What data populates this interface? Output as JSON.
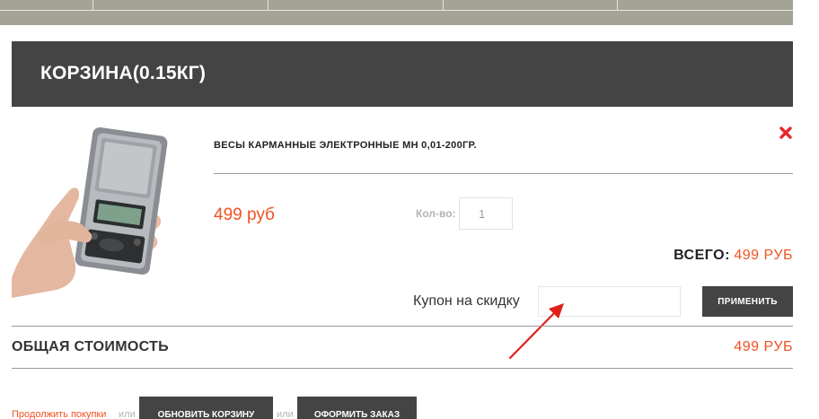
{
  "cart": {
    "title": "КОРЗИНА(0.15КГ)"
  },
  "product": {
    "title": "ВЕСЫ КАРМАННЫЕ ЭЛЕКТРОННЫЕ MH 0,01-200ГР.",
    "price": "499 руб",
    "qty_label": "Кол-во:",
    "qty_value": "1",
    "total_label": "ВСЕГО:",
    "total_value": "499 РУБ",
    "remove_icon": "close-icon"
  },
  "coupon": {
    "label": "Купон на скидку",
    "value": "",
    "apply_label": "ПРИМЕНИТЬ"
  },
  "summary": {
    "grand_label": "ОБЩАЯ СТОИМОСТЬ",
    "grand_value": "499 РУБ"
  },
  "actions": {
    "continue_label": "Продолжить покупки",
    "or_1": "или",
    "update_label": "ОБНОВИТЬ КОРЗИНУ",
    "or_2": "или",
    "checkout_label": "ОФОРМИТЬ ЗАКАЗ"
  },
  "colors": {
    "accent": "#f05222",
    "header_bg": "#444444",
    "nav_bg": "#a3a396",
    "annotation": "#e0201b"
  }
}
